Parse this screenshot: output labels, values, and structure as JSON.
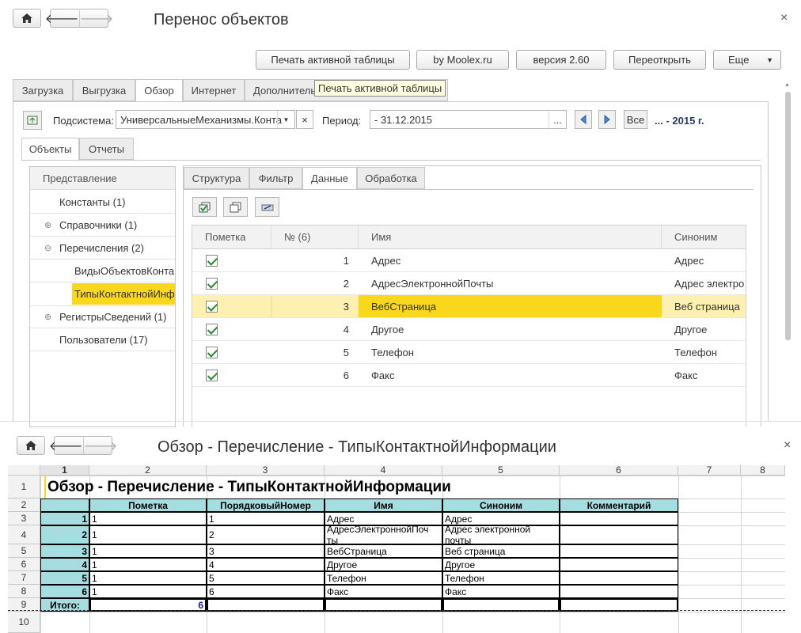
{
  "top_window": {
    "title": "Перенос объектов",
    "close_glyph": "×",
    "toolbar": {
      "print_label": "Печать активной таблицы",
      "moolex_label": "by Moolex.ru",
      "version_label": "версия 2.60",
      "reopen_label": "Переоткрыть",
      "more_label": "Еще"
    },
    "tabs": [
      "Загрузка",
      "Выгрузка",
      "Обзор",
      "Интернет",
      "Дополнитель"
    ],
    "active_tab": "Обзор",
    "tooltip": "Печать активной таблицы",
    "subsystem_label": "Подсистема:",
    "subsystem_value": "УниверсальныеМеханизмы.Конта",
    "subsystem_clear": "×",
    "period_label": "Период:",
    "period_value": "- 31.12.2015",
    "period_ellipsis": "...",
    "all_label": "Все",
    "period_text": "... - 2015 г.",
    "subtabs": [
      "Объекты",
      "Отчеты"
    ],
    "tree_header": "Представление",
    "tree": [
      {
        "label": "Константы (1)",
        "expander": "",
        "level": 0
      },
      {
        "label": "Справочники (1)",
        "expander": "⊕",
        "level": 0
      },
      {
        "label": "Перечисления (2)",
        "expander": "⊖",
        "level": 0
      },
      {
        "label": "ВидыОбъектовКонта",
        "expander": "",
        "level": 1
      },
      {
        "label": "ТипыКонтактнойИнфо",
        "expander": "",
        "level": 1,
        "selected": true
      },
      {
        "label": "РегистрыСведений (1)",
        "expander": "⊕",
        "level": 0
      },
      {
        "label": "Пользователи (17)",
        "expander": "",
        "level": 0
      }
    ],
    "data_tabs": [
      "Структура",
      "Фильтр",
      "Данные",
      "Обработка"
    ],
    "active_data_tab": "Данные",
    "grid": {
      "columns": [
        "Пометка",
        "№ (6)",
        "Имя",
        "Синоним"
      ],
      "rows": [
        {
          "num": "1",
          "name": "Адрес",
          "syn": "Адрес"
        },
        {
          "num": "2",
          "name": "АдресЭлектроннойПочты",
          "syn": "Адрес электро"
        },
        {
          "num": "3",
          "name": "ВебСтраница",
          "syn": "Веб страница"
        },
        {
          "num": "4",
          "name": "Другое",
          "syn": "Другое"
        },
        {
          "num": "5",
          "name": "Телефон",
          "syn": "Телефон"
        },
        {
          "num": "6",
          "name": "Факс",
          "syn": "Факс"
        }
      ]
    }
  },
  "bottom_window": {
    "title": "Обзор - Перечисление - ТипыКонтактнойИнформации",
    "close_glyph": "×",
    "col_headers": [
      "1",
      "2",
      "3",
      "4",
      "5",
      "6",
      "7",
      "8"
    ],
    "row_headers": [
      "1",
      "2",
      "3",
      "4",
      "5",
      "6",
      "7",
      "8",
      "9",
      "10"
    ],
    "report_title": "Обзор - Перечисление - ТипыКонтактнойИнформации",
    "table_headers": [
      "Пометка",
      "ПорядковыйНомер",
      "Имя",
      "Синоним",
      "Комментарий"
    ],
    "table_rows": [
      {
        "n": "1",
        "mark": "1",
        "order": "1",
        "name": "Адрес",
        "syn": "Адрес"
      },
      {
        "n": "2",
        "mark": "1",
        "order": "2",
        "name": "АдресЭлектроннойПоч",
        "name2": "ты",
        "syn": "Адрес электронной",
        "syn2": "почты"
      },
      {
        "n": "3",
        "mark": "1",
        "order": "3",
        "name": "ВебСтраница",
        "syn": "Веб страница"
      },
      {
        "n": "4",
        "mark": "1",
        "order": "4",
        "name": "Другое",
        "syn": "Другое"
      },
      {
        "n": "5",
        "mark": "1",
        "order": "5",
        "name": "Телефон",
        "syn": "Телефон"
      },
      {
        "n": "6",
        "mark": "1",
        "order": "6",
        "name": "Факс",
        "syn": "Факс"
      }
    ],
    "total_label": "Итого:",
    "total_value": "6"
  },
  "colors": {
    "accent_yellow": "#f9d71c",
    "row_highlight": "#fdf0b0",
    "header_cyan": "#a6dde0",
    "link_blue": "#1a1ab0"
  }
}
